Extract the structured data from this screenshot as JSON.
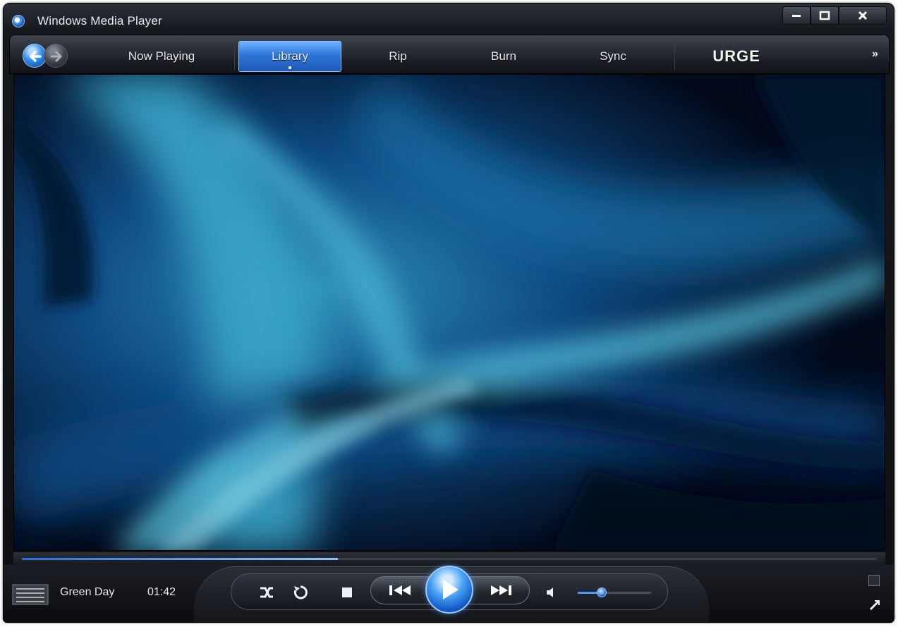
{
  "window": {
    "title": "Windows Media Player",
    "buttons": {
      "minimize": "minimize",
      "maximize": "maximize",
      "close": "close"
    }
  },
  "nav": {
    "tabs": [
      {
        "label": "Now Playing"
      },
      {
        "label": "Library",
        "active": true
      },
      {
        "label": "Rip"
      },
      {
        "label": "Burn"
      },
      {
        "label": "Sync"
      },
      {
        "label": "URGE"
      }
    ],
    "more_label": "»"
  },
  "now_playing": {
    "track": "Green Day",
    "time": "01:42",
    "seek_progress": 0.37,
    "volume": 0.33
  },
  "icons": {
    "back": "back-arrow-icon",
    "forward": "forward-arrow-icon",
    "shuffle": "shuffle-icon",
    "repeat": "repeat-icon",
    "stop": "stop-icon",
    "previous": "previous-icon",
    "play": "play-icon",
    "next": "next-icon",
    "mute": "speaker-icon",
    "album": "album-art-icon",
    "mini_mode": "mini-mode-icon"
  },
  "colors": {
    "accent": "#2e76d8",
    "viz_deep": "#041229",
    "viz_light": "#3fb6d8"
  }
}
